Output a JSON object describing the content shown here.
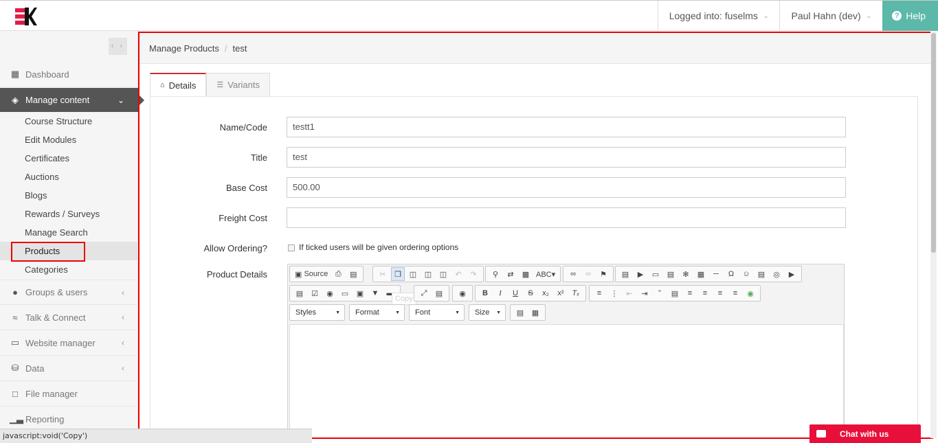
{
  "header": {
    "logged_into": "Logged into: fuselms",
    "user": "Paul Hahn (dev)",
    "help": "Help",
    "colors": {
      "help_bg": "#5cb8a8",
      "logo_red": "#e11d48"
    }
  },
  "sidebar": {
    "items": [
      {
        "label": "Dashboard",
        "icon": "dashboard-icon"
      },
      {
        "label": "Manage content",
        "icon": "layers-icon"
      },
      {
        "label": "Groups & users",
        "icon": "user-icon"
      },
      {
        "label": "Talk & Connect",
        "icon": "wifi-icon"
      },
      {
        "label": "Website manager",
        "icon": "laptop-icon"
      },
      {
        "label": "Data",
        "icon": "database-icon"
      },
      {
        "label": "File manager",
        "icon": "file-icon"
      },
      {
        "label": "Reporting",
        "icon": "bar-chart-icon"
      }
    ],
    "submenu": [
      "Course Structure",
      "Edit Modules",
      "Certificates",
      "Auctions",
      "Blogs",
      "Rewards / Surveys",
      "Manage Search",
      "Products",
      "Categories"
    ]
  },
  "breadcrumb": {
    "parent": "Manage Products",
    "sep": "/",
    "current": "test"
  },
  "tabs": [
    {
      "label": "Details",
      "icon": "home-icon"
    },
    {
      "label": "Variants",
      "icon": "list-icon"
    }
  ],
  "form": {
    "name_code": {
      "label": "Name/Code",
      "value": "testt1"
    },
    "title": {
      "label": "Title",
      "value": "test"
    },
    "base_cost": {
      "label": "Base Cost",
      "value": "500.00"
    },
    "freight_cost": {
      "label": "Freight Cost",
      "value": ""
    },
    "allow_ordering": {
      "label": "Allow Ordering?",
      "help": "If ticked users will be given ordering options"
    },
    "product_details": {
      "label": "Product Details"
    }
  },
  "editor": {
    "source_label": "Source",
    "tooltip": "Copy",
    "combos": {
      "styles": "Styles",
      "format": "Format",
      "font": "Font",
      "size": "Size"
    }
  },
  "status_bar": "javascript:void('Copy')",
  "chat": "Chat with us"
}
